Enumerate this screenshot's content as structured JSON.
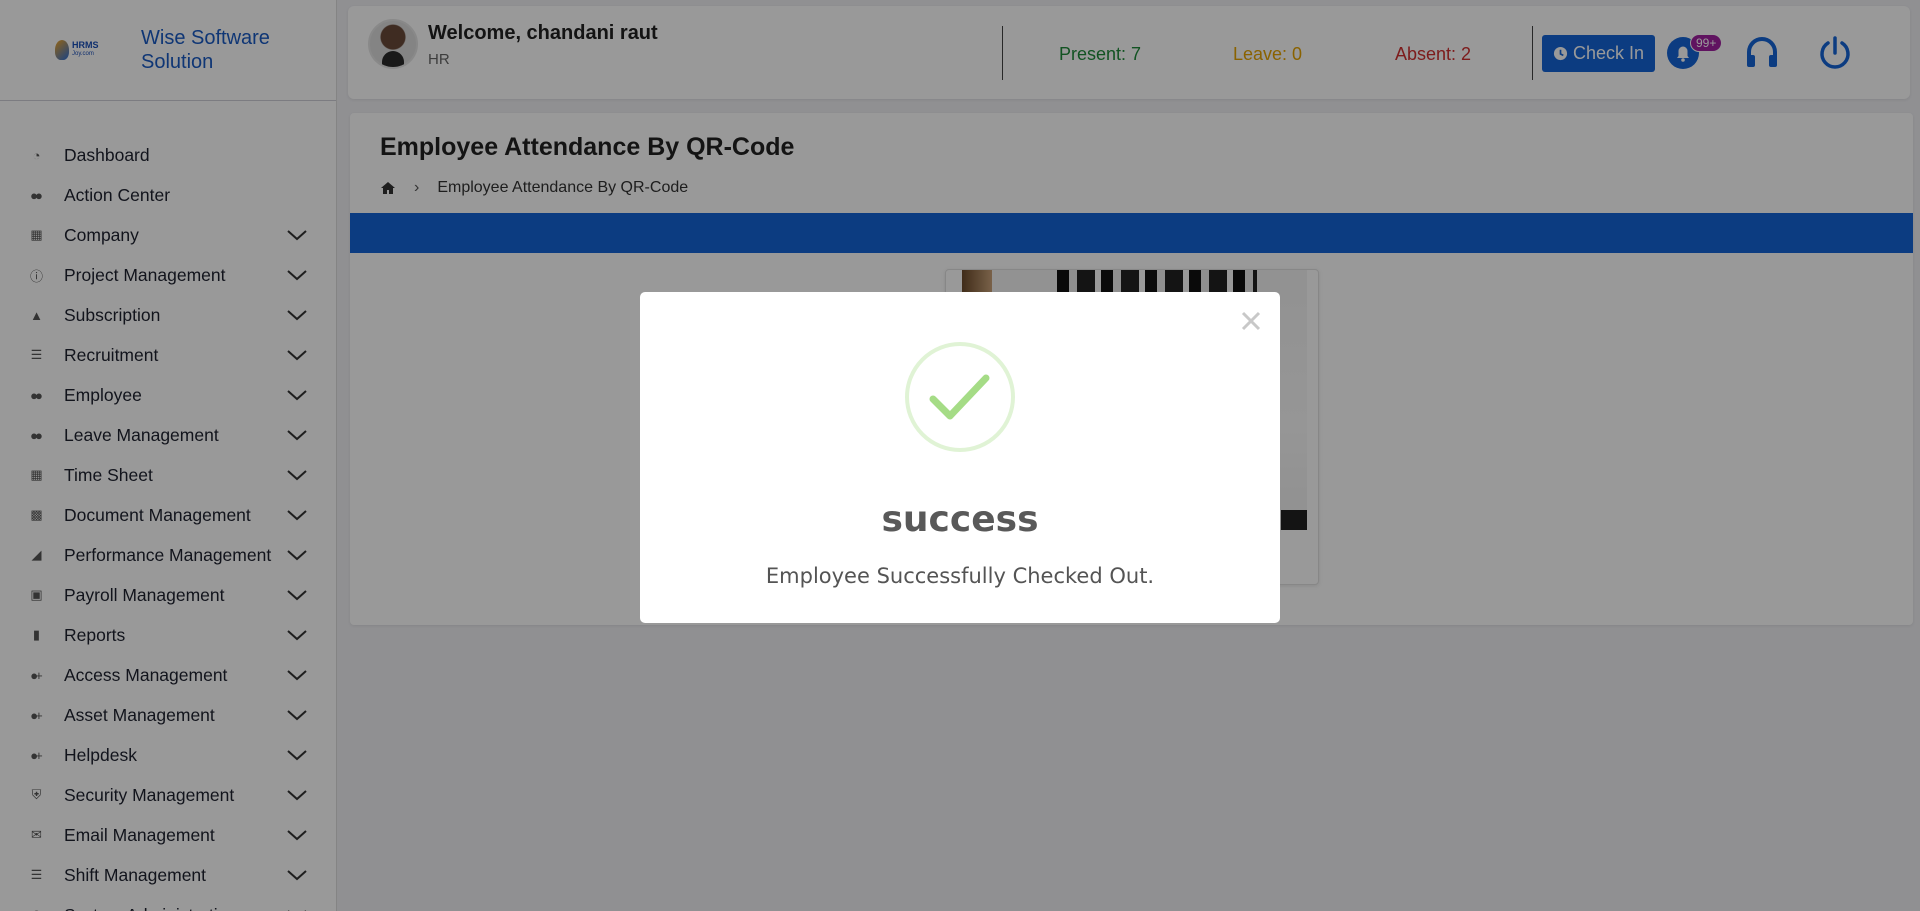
{
  "brand": {
    "name": "Wise Software Solution",
    "logo_text": "HRMS",
    "logo_sub": "Joy.com"
  },
  "sidebar": {
    "items": [
      {
        "label": "Dashboard",
        "icon": "dashboard-icon",
        "expandable": false
      },
      {
        "label": "Action Center",
        "icon": "users-icon",
        "expandable": false
      },
      {
        "label": "Company",
        "icon": "building-icon",
        "expandable": true
      },
      {
        "label": "Project Management",
        "icon": "info-circle-icon",
        "expandable": true
      },
      {
        "label": "Subscription",
        "icon": "bell-icon",
        "expandable": true
      },
      {
        "label": "Recruitment",
        "icon": "list-icon",
        "expandable": true
      },
      {
        "label": "Employee",
        "icon": "users-icon",
        "expandable": true
      },
      {
        "label": "Leave Management",
        "icon": "users-icon",
        "expandable": true
      },
      {
        "label": "Time Sheet",
        "icon": "calendar-icon",
        "expandable": true
      },
      {
        "label": "Document Management",
        "icon": "briefcase-icon",
        "expandable": true
      },
      {
        "label": "Performance Management",
        "icon": "area-chart-icon",
        "expandable": true
      },
      {
        "label": "Payroll Management",
        "icon": "money-icon",
        "expandable": true
      },
      {
        "label": "Reports",
        "icon": "bar-chart-icon",
        "expandable": true
      },
      {
        "label": "Access Management",
        "icon": "user-plus-icon",
        "expandable": true
      },
      {
        "label": "Asset Management",
        "icon": "user-plus-icon",
        "expandable": true
      },
      {
        "label": "Helpdesk",
        "icon": "user-plus-icon",
        "expandable": true
      },
      {
        "label": "Security Management",
        "icon": "shield-icon",
        "expandable": true
      },
      {
        "label": "Email Management",
        "icon": "envelope-icon",
        "expandable": true
      },
      {
        "label": "Shift Management",
        "icon": "server-icon",
        "expandable": true
      },
      {
        "label": "System Administration",
        "icon": "globe-icon",
        "expandable": true
      }
    ]
  },
  "header": {
    "welcome": "Welcome, chandani raut",
    "role": "HR",
    "present": "Present: 7",
    "leave": "Leave: 0",
    "absent": "Absent: 2",
    "checkin_label": "Check In",
    "notification_count": "99+"
  },
  "main": {
    "title": "Employee Attendance By QR-Code",
    "breadcrumb": "Employee Attendance By QR-Code"
  },
  "modal": {
    "title": "success",
    "message": "Employee Successfully Checked Out."
  },
  "colors": {
    "primary": "#1565d8",
    "present": "#1e8a3a",
    "leave": "#e6a400",
    "absent": "#d03030",
    "success_check": "#a5dc86"
  }
}
